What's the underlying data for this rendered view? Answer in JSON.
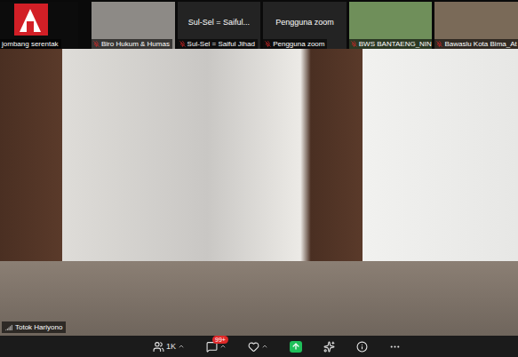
{
  "tiles": [
    {
      "kind": "logo",
      "label": "jombang serentak",
      "caption": "",
      "muted": false,
      "color": "#0c0c0c"
    },
    {
      "kind": "video",
      "label": "Biro Hukum & Humas",
      "caption": "",
      "muted": true,
      "color": "#8d8a86"
    },
    {
      "kind": "name",
      "label": "Sul-Sel = Saiful Jihad",
      "caption": "Sul-Sel = Saiful...",
      "muted": true,
      "color": "#232323"
    },
    {
      "kind": "name",
      "label": "Pengguna zoom",
      "caption": "Pengguna zoom",
      "muted": true,
      "color": "#232323"
    },
    {
      "kind": "video",
      "label": "BWS BANTAENG_NIN",
      "caption": "",
      "muted": true,
      "color": "#6f8f5a"
    },
    {
      "kind": "video",
      "label": "Bawaslu Kota Bima_At",
      "caption": "",
      "muted": true,
      "color": "#7a6a58"
    }
  ],
  "speaker": {
    "name": "Totok Hariyono"
  },
  "toolbar": [
    {
      "kind": "participants",
      "count": "1K",
      "badge": "",
      "caret": true
    },
    {
      "kind": "chat",
      "count": "",
      "badge": "99+",
      "caret": true
    },
    {
      "kind": "reactions",
      "count": "",
      "badge": "",
      "caret": true
    },
    {
      "kind": "share",
      "count": "",
      "badge": "",
      "caret": false
    },
    {
      "kind": "companion",
      "count": "",
      "badge": "",
      "caret": false
    },
    {
      "kind": "info",
      "count": "",
      "badge": "",
      "caret": false
    },
    {
      "kind": "more",
      "count": "",
      "badge": "",
      "caret": false
    }
  ]
}
